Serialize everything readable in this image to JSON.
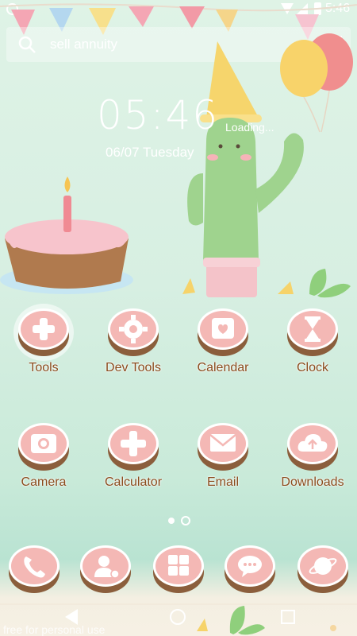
{
  "status_bar": {
    "time": "5:46"
  },
  "search": {
    "text": "sell annuity"
  },
  "clock": {
    "time": "05:46",
    "date": "06/07  Tuesday"
  },
  "widget": {
    "loading": "Loading..."
  },
  "apps_row1": [
    {
      "label": "Tools",
      "icon": "plus-icon"
    },
    {
      "label": "Dev Tools",
      "icon": "gear-icon"
    },
    {
      "label": "Calendar",
      "icon": "calendar-icon"
    },
    {
      "label": "Clock",
      "icon": "hourglass-icon"
    }
  ],
  "apps_row2": [
    {
      "label": "Camera",
      "icon": "camera-icon"
    },
    {
      "label": "Calculator",
      "icon": "plus-icon"
    },
    {
      "label": "Email",
      "icon": "envelope-icon"
    },
    {
      "label": "Downloads",
      "icon": "cloud-upload-icon"
    }
  ],
  "dock": [
    {
      "icon": "phone-icon"
    },
    {
      "icon": "contacts-icon"
    },
    {
      "icon": "app-grid-icon"
    },
    {
      "icon": "message-icon"
    },
    {
      "icon": "browser-planet-icon"
    }
  ],
  "page_indicator": {
    "pages": 2,
    "active": 2
  },
  "watermark": "free for personal use",
  "colors": {
    "label": "#8b4b1c",
    "icon_top": "#f4b8b5",
    "icon_base": "#8b5e3c",
    "background": "#d7efe2"
  }
}
